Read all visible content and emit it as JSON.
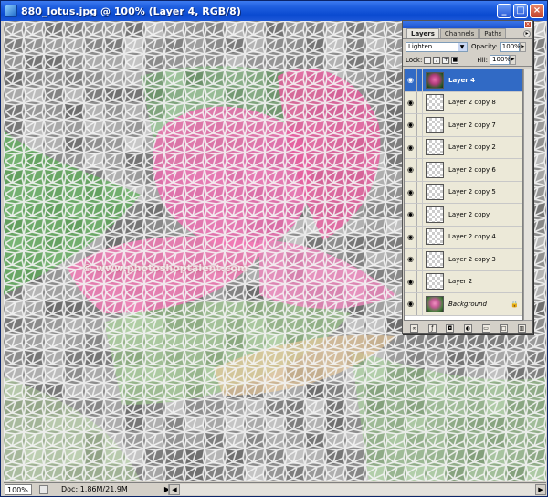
{
  "window": {
    "title": "880_lotus.jpg @ 100% (Layer 4, RGB/8)",
    "buttons": [
      "_",
      "□",
      "×"
    ]
  },
  "canvas": {
    "watermark": "© www.photoshoptalent.com"
  },
  "status": {
    "zoom": "100%",
    "doc_info": "Doc: 1,86M/21,9M",
    "arrow": "▶"
  },
  "layers_panel": {
    "tabs": [
      "Layers",
      "Channels",
      "Paths"
    ],
    "blend_mode": "Lighten",
    "opacity_label": "Opacity:",
    "opacity_value": "100%",
    "lock_label": "Lock:",
    "fill_label": "Fill:",
    "fill_value": "100%",
    "layers": [
      {
        "name": "Layer 4",
        "selected": true,
        "thumb": "lotus"
      },
      {
        "name": "Layer 2 copy 8",
        "thumb": "checker"
      },
      {
        "name": "Layer 2 copy 7",
        "thumb": "checker"
      },
      {
        "name": "Layer 2 copy 2",
        "thumb": "checker"
      },
      {
        "name": "Layer 2 copy 6",
        "thumb": "checker"
      },
      {
        "name": "Layer 2 copy 5",
        "thumb": "checker"
      },
      {
        "name": "Layer 2 copy",
        "thumb": "checker"
      },
      {
        "name": "Layer 2 copy 4",
        "thumb": "checker"
      },
      {
        "name": "Layer 2 copy 3",
        "thumb": "checker"
      },
      {
        "name": "Layer 2",
        "thumb": "checker"
      },
      {
        "name": "Background",
        "thumb": "bg",
        "locked": true
      }
    ]
  },
  "colors": {
    "titlebar": "#0a4ad0",
    "selected_layer": "#316ac5",
    "lotus_pink": "#e56fae",
    "leaf_green": "#8fcf7a",
    "mosaic_gray": "#9a9a9a"
  }
}
